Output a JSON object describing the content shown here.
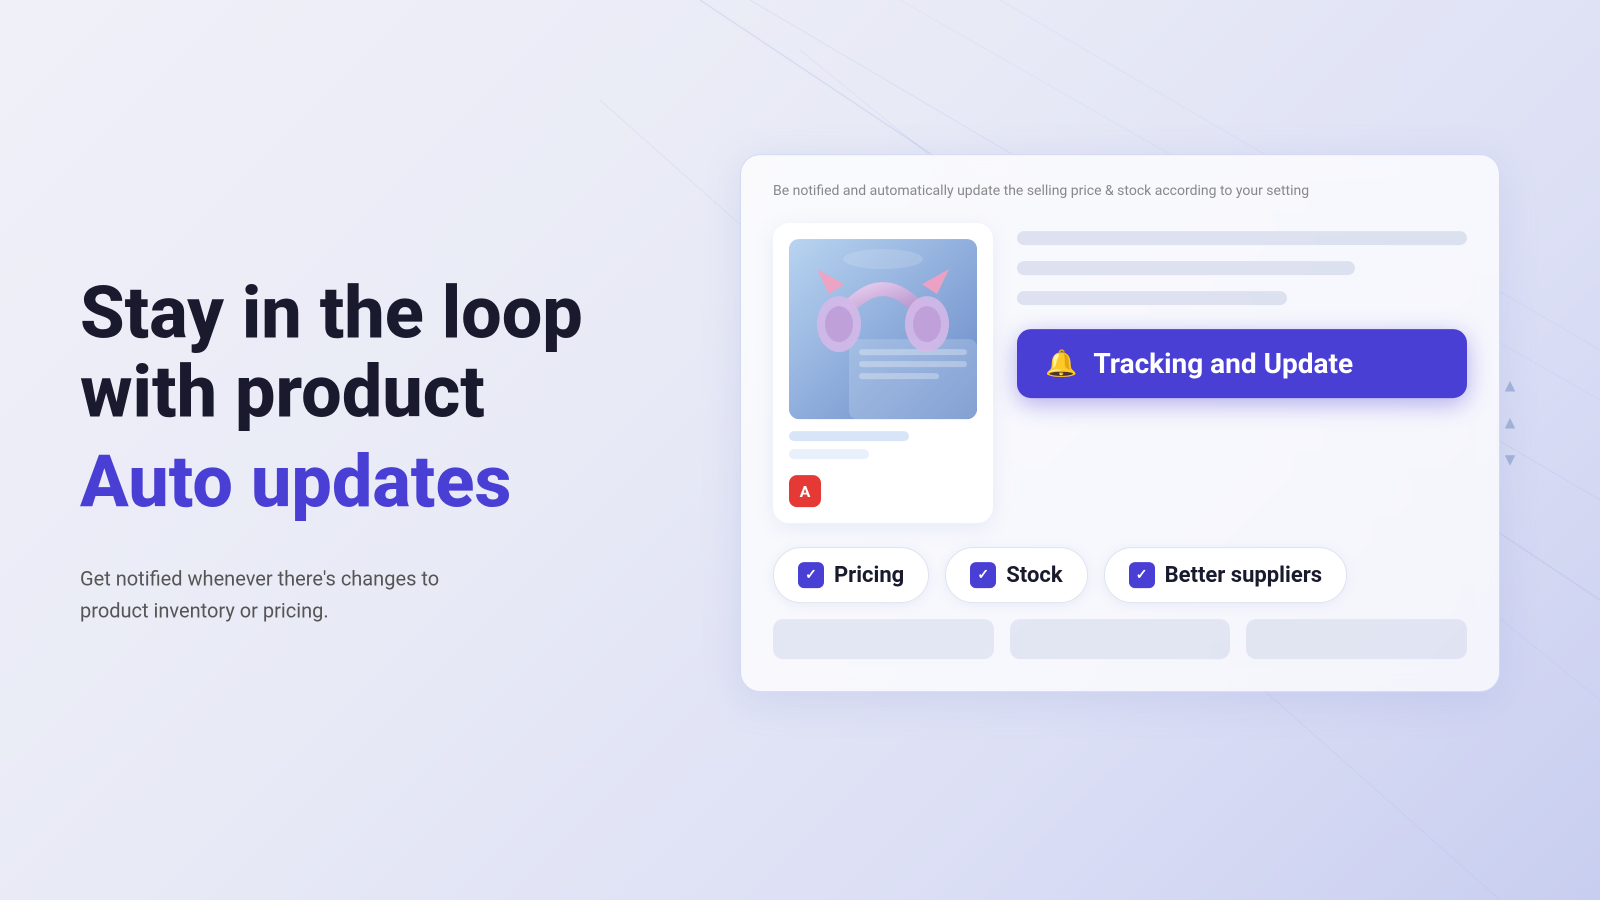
{
  "background": {
    "gradient_start": "#f0f0f8",
    "gradient_end": "#c8cef0"
  },
  "left": {
    "headline_line1": "Stay in the loop",
    "headline_line2": "with product",
    "headline_accent": "Auto updates",
    "subtext_line1": "Get notified whenever there's changes to",
    "subtext_line2": "product inventory or pricing."
  },
  "card": {
    "subtitle": "Be notified and automatically update the selling price & stock according to your setting",
    "tracking_button_label": "Tracking and Update",
    "bell_icon": "🔔",
    "badges": [
      {
        "label": "Pricing",
        "checked": true
      },
      {
        "label": "Stock",
        "checked": true
      },
      {
        "label": "Better suppliers",
        "checked": true
      }
    ],
    "product_logo": "A"
  }
}
